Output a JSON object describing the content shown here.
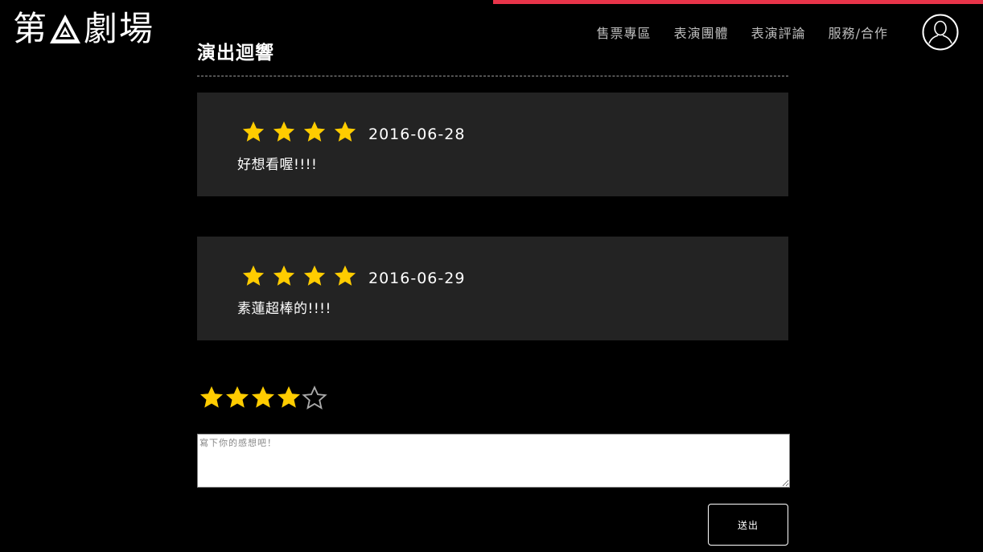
{
  "logo": {
    "char_1": "第",
    "char_2": "劇",
    "char_3": "場"
  },
  "nav": {
    "items": [
      {
        "label": "售票專區"
      },
      {
        "label": "表演團體"
      },
      {
        "label": "表演評論"
      },
      {
        "label": "服務/合作"
      }
    ]
  },
  "section": {
    "title": "演出迴響"
  },
  "reviews": [
    {
      "stars": 4,
      "date": "2016-06-28",
      "comment": "好想看喔!!!!"
    },
    {
      "stars": 4,
      "date": "2016-06-29",
      "comment": "素蓮超棒的!!!!"
    }
  ],
  "rating_input": {
    "value": 4,
    "max": 5
  },
  "comment_form": {
    "placeholder": "寫下你的感想吧！",
    "submit_label": "送出"
  },
  "colors": {
    "accent": "#e8344a",
    "star": "#ffcc00",
    "card_bg": "#232323",
    "background": "#000000"
  }
}
